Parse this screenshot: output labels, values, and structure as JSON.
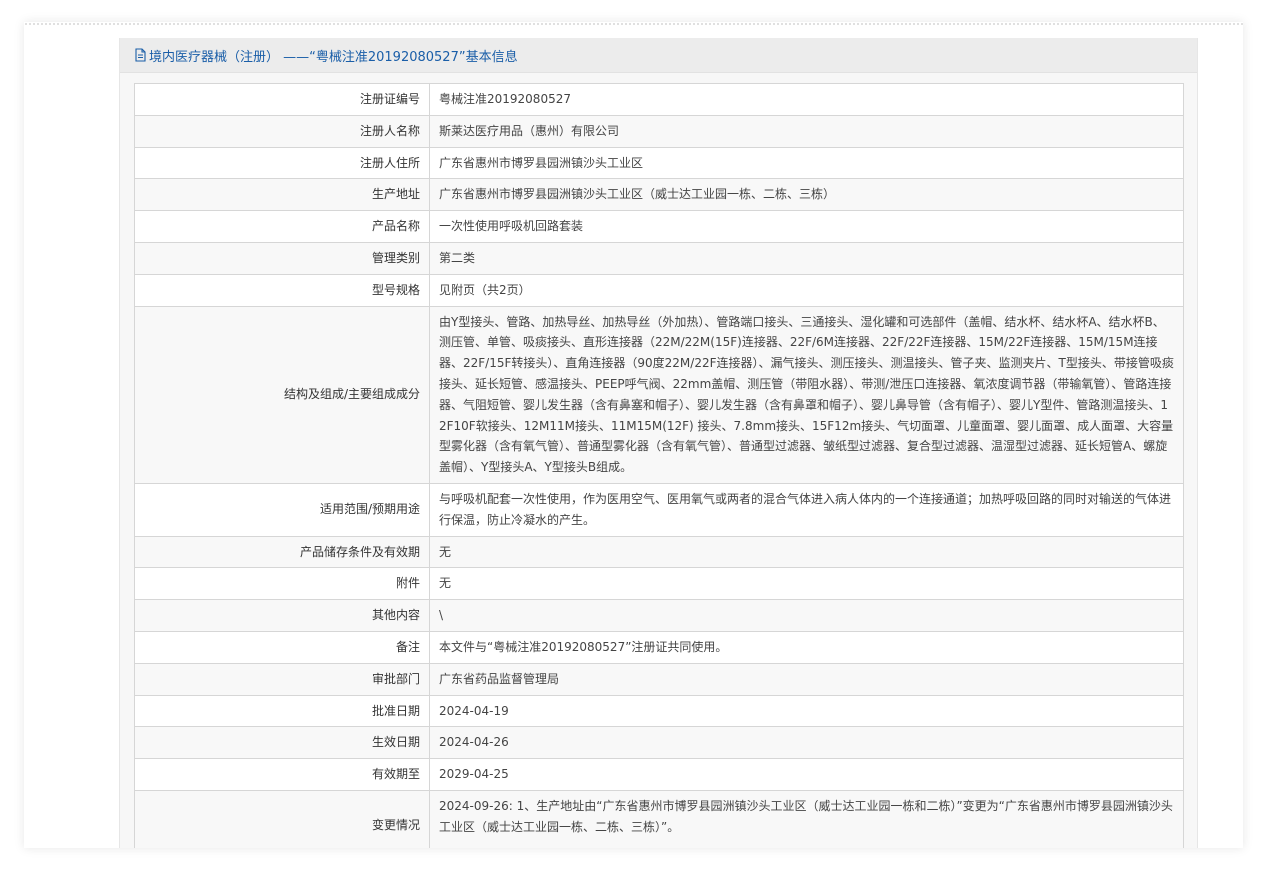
{
  "header": {
    "title": "境内医疗器械（注册） ——“粤械注准20192080527”基本信息",
    "icon": "document-icon",
    "accent_color": "#1a5ea8"
  },
  "fields": [
    {
      "label": "注册证编号",
      "value": "粤械注准20192080527"
    },
    {
      "label": "注册人名称",
      "value": "斯莱达医疗用品（惠州）有限公司"
    },
    {
      "label": "注册人住所",
      "value": "广东省惠州市博罗县园洲镇沙头工业区"
    },
    {
      "label": "生产地址",
      "value": "广东省惠州市博罗县园洲镇沙头工业区（威士达工业园一栋、二栋、三栋）"
    },
    {
      "label": "产品名称",
      "value": "一次性使用呼吸机回路套装"
    },
    {
      "label": "管理类别",
      "value": "第二类"
    },
    {
      "label": "型号规格",
      "value": "见附页（共2页）"
    },
    {
      "label": "结构及组成/主要组成成分",
      "value": "由Y型接头、管路、加热导丝、加热导丝（外加热）、管路端口接头、三通接头、湿化罐和可选部件（盖帽、结水杯、结水杯A、结水杯B、测压管、单管、吸痰接头、直形连接器（22M/22M(15F)连接器、22F/6M连接器、22F/22F连接器、15M/22F连接器、15M/15M连接器、22F/15F转接头）、直角连接器（90度22M/22F连接器）、漏气接头、测压接头、测温接头、管子夹、监测夹片、T型接头、带接管吸痰接头、延长短管、感温接头、PEEP呼气阀、22mm盖帽、测压管（带阻水器）、带测/泄压口连接器、氧浓度调节器（带输氧管）、管路连接器、气阻短管、婴儿发生器（含有鼻塞和帽子）、婴儿发生器（含有鼻罩和帽子）、婴儿鼻导管（含有帽子）、婴儿Y型件、管路测温接头、12F10F软接头、12M11M接头、11M15M(12F) 接头、7.8mm接头、15F12m接头、气切面罩、儿童面罩、婴儿面罩、成人面罩、大容量型雾化器（含有氧气管）、普通型雾化器（含有氧气管）、普通型过滤器、皱纸型过滤器、复合型过滤器、温湿型过滤器、延长短管A、螺旋盖帽）、Y型接头A、Y型接头B组成。"
    },
    {
      "label": "适用范围/预期用途",
      "value": "与呼吸机配套一次性使用，作为医用空气、医用氧气或两者的混合气体进入病人体内的一个连接通道；加热呼吸回路的同时对输送的气体进行保温，防止冷凝水的产生。"
    },
    {
      "label": "产品储存条件及有效期",
      "value": "无"
    },
    {
      "label": "附件",
      "value": "无"
    },
    {
      "label": "其他内容",
      "value": "\\"
    },
    {
      "label": "备注",
      "value": "本文件与“粤械注准20192080527”注册证共同使用。"
    },
    {
      "label": "审批部门",
      "value": "广东省药品监督管理局"
    },
    {
      "label": "批准日期",
      "value": "2024-04-19"
    },
    {
      "label": "生效日期",
      "value": "2024-04-26"
    },
    {
      "label": "有效期至",
      "value": "2029-04-25"
    },
    {
      "label": "变更情况",
      "value": "2024-09-26: 1、生产地址由“广东省惠州市博罗县园洲镇沙头工业区（威士达工业园一栋和二栋）”变更为“广东省惠州市博罗县园洲镇沙头工业区（威士达工业园一栋、二栋、三栋）”。"
    }
  ]
}
